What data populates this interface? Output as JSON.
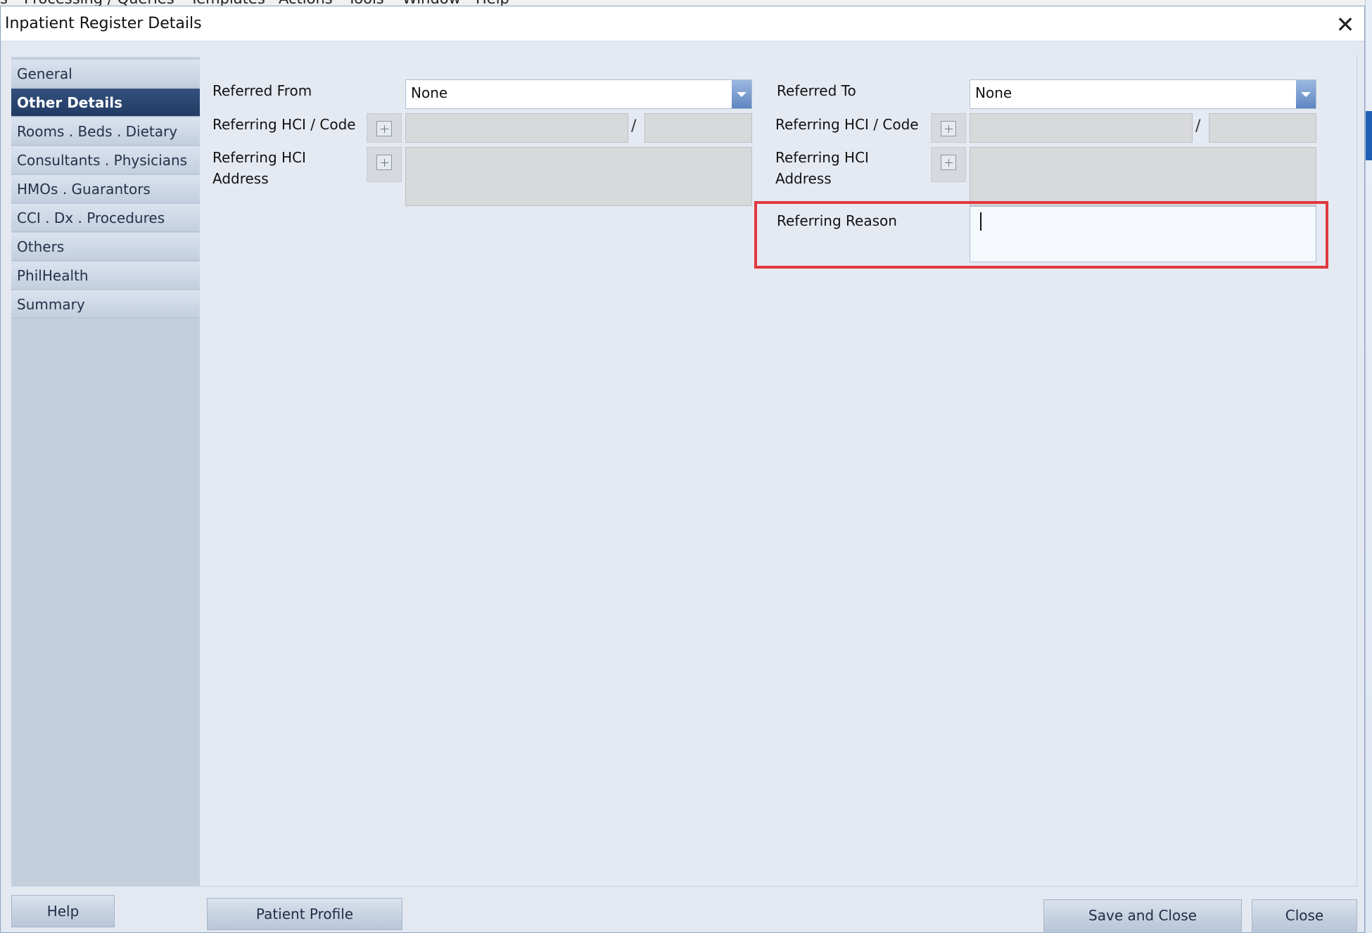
{
  "background_app": {
    "menubar": [
      "s",
      "Processing / Queries",
      "Templates",
      "Actions",
      "Tools",
      "Window",
      "Help"
    ]
  },
  "dialog": {
    "title": "Inpatient Register Details",
    "close_glyph": "✕"
  },
  "sidebar": {
    "items": [
      {
        "label": "General",
        "active": false
      },
      {
        "label": "Other Details",
        "active": true
      },
      {
        "label": "Rooms . Beds . Dietary",
        "active": false
      },
      {
        "label": "Consultants . Physicians",
        "active": false
      },
      {
        "label": "HMOs . Guarantors",
        "active": false
      },
      {
        "label": "CCI . Dx . Procedures",
        "active": false
      },
      {
        "label": "Others",
        "active": false
      },
      {
        "label": "PhilHealth",
        "active": false
      },
      {
        "label": "Summary",
        "active": false
      }
    ]
  },
  "form": {
    "left": {
      "referred_from_label": "Referred From",
      "referred_from_value": "None",
      "hci_code_label": "Referring HCI / Code",
      "hci_code_separator": "/",
      "hci_address_label_line1": "Referring HCI",
      "hci_address_label_line2": "Address"
    },
    "right": {
      "referred_to_label": "Referred To",
      "referred_to_value": "None",
      "hci_code_label": "Referring HCI / Code",
      "hci_code_separator": "/",
      "hci_address_label_line1": "Referring HCI",
      "hci_address_label_line2": "Address",
      "referring_reason_label": "Referring Reason",
      "referring_reason_value": ""
    }
  },
  "footer": {
    "help_label": "Help",
    "patient_profile_label": "Patient Profile",
    "save_and_close_label": "Save and Close",
    "close_label": "Close"
  },
  "colors": {
    "highlight": "#e0393e",
    "sidebar_active": "#213b63",
    "dialog_bg": "#e4e9f1"
  }
}
